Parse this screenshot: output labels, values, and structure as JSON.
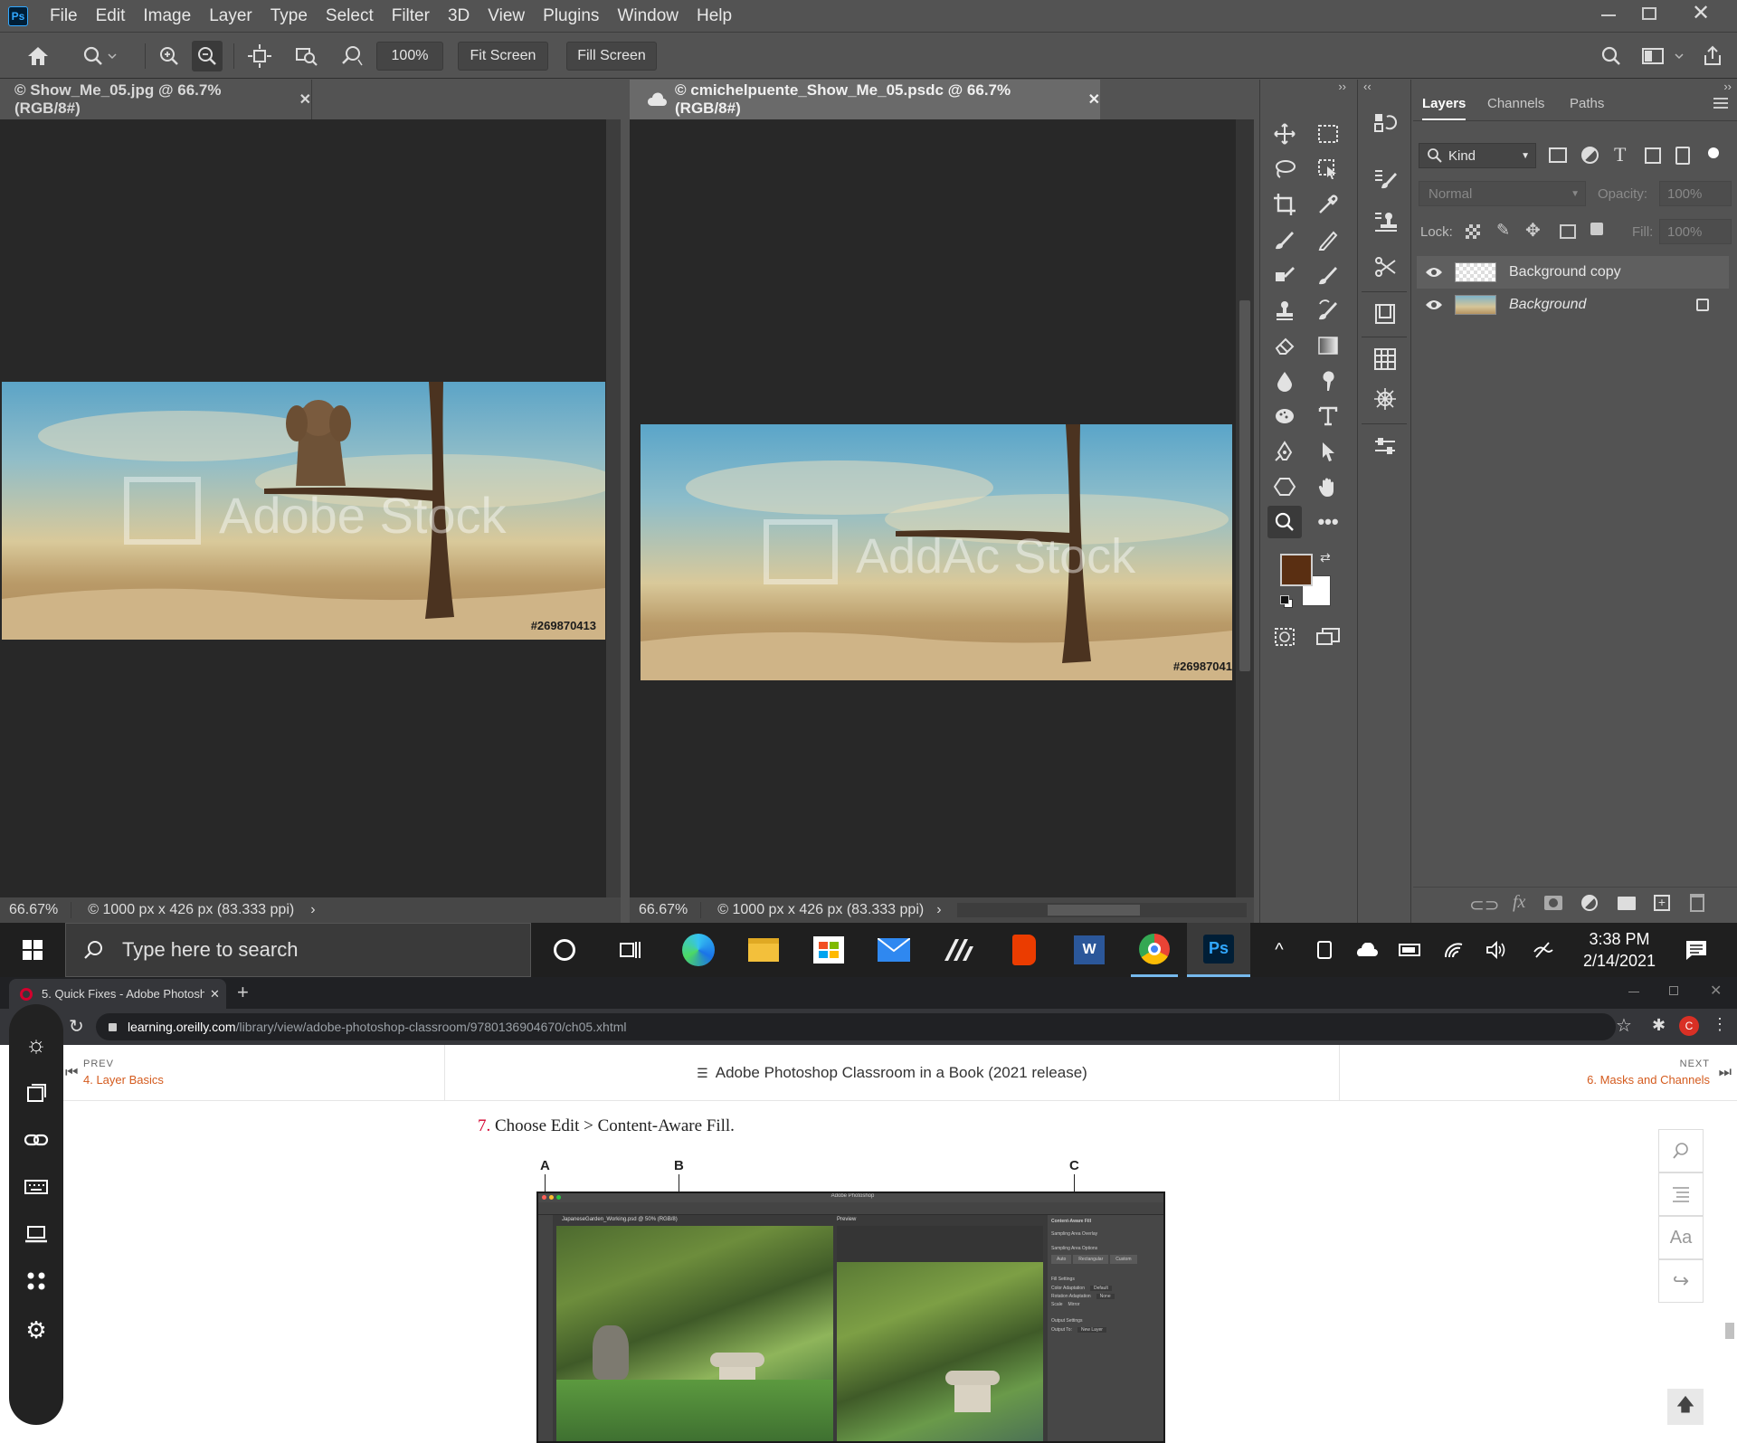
{
  "photoshop": {
    "menu": [
      "File",
      "Edit",
      "Image",
      "Layer",
      "Type",
      "Select",
      "Filter",
      "3D",
      "View",
      "Plugins",
      "Window",
      "Help"
    ],
    "zoom_value": "100%",
    "fit_screen": "Fit Screen",
    "fill_screen": "Fill Screen",
    "doc1": {
      "tab": "© Show_Me_05.jpg @ 66.7% (RGB/8#)",
      "zoom": "66.67%",
      "info": "© 1000 px x 426 px (83.333 ppi)",
      "watermark": "Adobe Stock",
      "stock_id": "#269870413"
    },
    "doc2": {
      "tab": "© cmichelpuente_Show_Me_05.psdc @ 66.7% (RGB/8#)",
      "zoom": "66.67%",
      "info": "© 1000 px x 426 px (83.333 ppi)",
      "watermark": "AddAc Stock",
      "stock_id": "#26987041"
    },
    "layers_panel": {
      "tabs": [
        "Layers",
        "Channels",
        "Paths"
      ],
      "filter": "Kind",
      "blend_mode": "Normal",
      "opacity_label": "Opacity:",
      "opacity": "100%",
      "lock_label": "Lock:",
      "fill_label": "Fill:",
      "fill": "100%",
      "layers": [
        {
          "name": "Background copy"
        },
        {
          "name": "Background"
        }
      ]
    },
    "colors": {
      "foreground": "#5a2f12",
      "background": "#ffffff",
      "accent": "#31a8ff"
    }
  },
  "taskbar": {
    "search_placeholder": "Type here to search",
    "time": "3:38 PM",
    "date": "2/14/2021"
  },
  "browser": {
    "tab_title": "5. Quick Fixes - Adobe Photosho",
    "url_domain": "learning.oreilly.com",
    "url_path": "/library/view/adobe-photoshop-classroom/9780136904670/ch05.xhtml",
    "prev_label": "PREV",
    "prev_link": "4. Layer Basics",
    "book_title": "Adobe Photoshop Classroom in a Book (2021 release)",
    "next_label": "NEXT",
    "next_link": "6. Masks and Channels",
    "step_number": "7.",
    "step_text": "Choose Edit > Content-Aware Fill.",
    "callouts": [
      "A",
      "B",
      "C"
    ],
    "figure": {
      "title": "Adobe Photoshop",
      "doc_tab": "JapaneseGarden_Working.psd @ 50% (RGB/8)",
      "preview_label": "Preview",
      "panel_title": "Content-Aware Fill",
      "panel_items": [
        "Sampling Area Overlay",
        "Sampling Area Options",
        "Auto",
        "Rectangular",
        "Custom",
        "Fill Settings",
        "Color Adaptation",
        "Default",
        "Rotation Adaptation",
        "None",
        "Scale",
        "Mirror",
        "Output Settings",
        "Output To:",
        "New Layer"
      ]
    }
  }
}
